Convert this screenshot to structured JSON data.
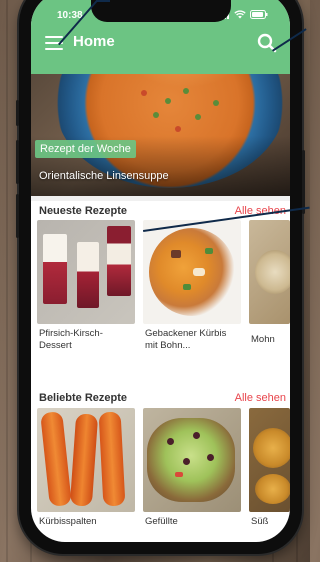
{
  "status": {
    "time": "10:38"
  },
  "header": {
    "title": "Home",
    "menu_icon": "hamburger-menu-icon",
    "search_icon": "search-icon"
  },
  "hero": {
    "badge": "Rezept der Woche",
    "title": "Orientalische Linsensuppe"
  },
  "newest": {
    "title": "Neueste Rezepte",
    "see_all": "Alle sehen",
    "items": [
      {
        "label": "Pfirsich-Kirsch-Dessert"
      },
      {
        "label": "Gebackener Kürbis mit Bohn..."
      },
      {
        "label": "Mohn"
      }
    ]
  },
  "popular": {
    "title": "Beliebte Rezepte",
    "see_all": "Alle sehen",
    "items": [
      {
        "label": "Kürbisspalten"
      },
      {
        "label": "Gefüllte"
      },
      {
        "label": "Süß"
      }
    ]
  },
  "colors": {
    "primary": "#6cc483",
    "accent": "#e8454c",
    "background": "#ffffff"
  }
}
